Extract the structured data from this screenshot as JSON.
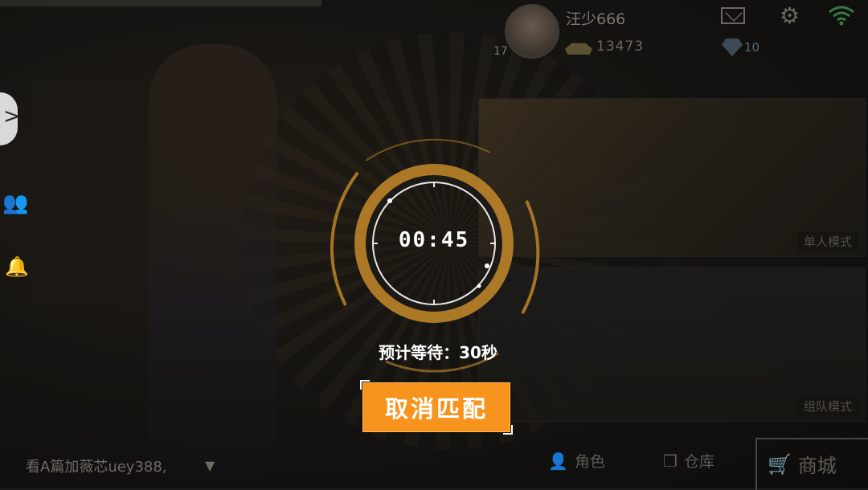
{
  "profile": {
    "username": "汪少666",
    "level": "17",
    "coins": "13473",
    "gems": "10"
  },
  "icons": {
    "mail": "mail-icon",
    "settings": "gear-icon",
    "wifi": "wifi-icon",
    "friends": "friends-icon",
    "bell": "bell-icon",
    "expand": "chevron-right-icon"
  },
  "modes": {
    "solo_label": "单人模式",
    "team_label": "组队模式"
  },
  "matching": {
    "timer": "00:45",
    "estimated_wait": "预计等待：30秒",
    "cancel_label": "取消匹配",
    "accent_color": "#f7941d"
  },
  "chat": {
    "text": "看A篇加薇芯uey388,"
  },
  "bottom_nav": {
    "character": "角色",
    "warehouse": "仓库",
    "shop": "商城"
  }
}
